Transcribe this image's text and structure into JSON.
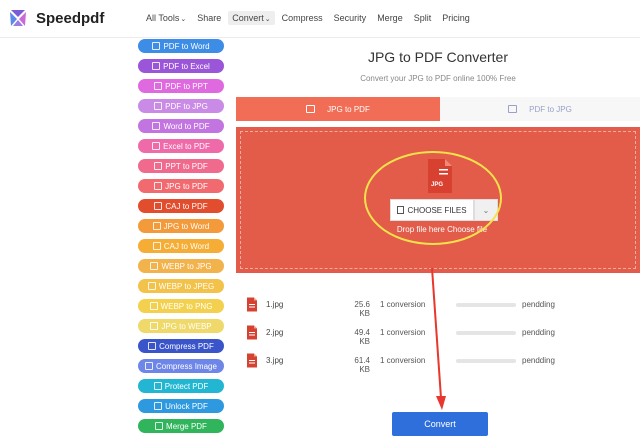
{
  "brand": {
    "name": "Speedpdf"
  },
  "nav": {
    "items": [
      {
        "label": "All Tools",
        "caret": true,
        "active": false
      },
      {
        "label": "Share",
        "caret": false,
        "active": false
      },
      {
        "label": "Convert",
        "caret": true,
        "active": true
      },
      {
        "label": "Compress",
        "caret": false,
        "active": false
      },
      {
        "label": "Security",
        "caret": false,
        "active": false
      },
      {
        "label": "Merge",
        "caret": false,
        "active": false
      },
      {
        "label": "Split",
        "caret": false,
        "active": false
      },
      {
        "label": "Pricing",
        "caret": false,
        "active": false
      }
    ]
  },
  "sidebar": {
    "items": [
      {
        "label": "PDF to Word",
        "color": "#3d8de6"
      },
      {
        "label": "PDF to Excel",
        "color": "#9b55d8"
      },
      {
        "label": "PDF to PPT",
        "color": "#df6ae0"
      },
      {
        "label": "PDF to JPG",
        "color": "#c98be6"
      },
      {
        "label": "Word to PDF",
        "color": "#c274e0"
      },
      {
        "label": "Excel to PDF",
        "color": "#ef6aa8"
      },
      {
        "label": "PPT to PDF",
        "color": "#f06a8d"
      },
      {
        "label": "JPG to PDF",
        "color": "#f16a6f"
      },
      {
        "label": "CAJ to PDF",
        "color": "#e24d2e"
      },
      {
        "label": "JPG to Word",
        "color": "#f39a3b"
      },
      {
        "label": "CAJ to Word",
        "color": "#f5ad35"
      },
      {
        "label": "WEBP to JPG",
        "color": "#f2b24c"
      },
      {
        "label": "WEBP to JPEG",
        "color": "#f3c24a"
      },
      {
        "label": "WEBP to PNG",
        "color": "#f3d14f"
      },
      {
        "label": "JPG to WEBP",
        "color": "#efd96a"
      },
      {
        "label": "Compress PDF",
        "color": "#3a55c9"
      },
      {
        "label": "Compress Image",
        "color": "#6f86e9"
      },
      {
        "label": "Protect PDF",
        "color": "#23b6d3"
      },
      {
        "label": "Unlock PDF",
        "color": "#2f99e0"
      },
      {
        "label": "Merge PDF",
        "color": "#30b45c"
      }
    ]
  },
  "main": {
    "title": "JPG to PDF Converter",
    "subtitle": "Convert your JPG to PDF online 100% Free",
    "tabs": [
      {
        "label": "JPG to PDF",
        "active": true
      },
      {
        "label": "PDF to JPG",
        "active": false
      }
    ],
    "dropzone": {
      "choose_label": "CHOOSE FILES",
      "dropdown_glyph": "⌄",
      "drop_text": "Drop file here Choose file",
      "file_badge": "JPG",
      "color": "#e35b49"
    },
    "files": [
      {
        "name": "1.jpg",
        "size": "25.6 KB",
        "conversions": "1 conversion",
        "status": "pendding",
        "progress": 0
      },
      {
        "name": "2.jpg",
        "size": "49.4 KB",
        "conversions": "1 conversion",
        "status": "pendding",
        "progress": 0
      },
      {
        "name": "3.jpg",
        "size": "61.4 KB",
        "conversions": "1 conversion",
        "status": "pendding",
        "progress": 0
      }
    ],
    "convert_label": "Convert"
  },
  "icons": {
    "logo": "speedpdf-logo-icon",
    "tab": "image-icon",
    "choose": "document-icon",
    "file": "pdf-file-icon"
  },
  "colors": {
    "accent": "#f16d55",
    "convert_button": "#2f6fdc",
    "annotation": "#e8372c",
    "highlight": "#f3e24b"
  }
}
